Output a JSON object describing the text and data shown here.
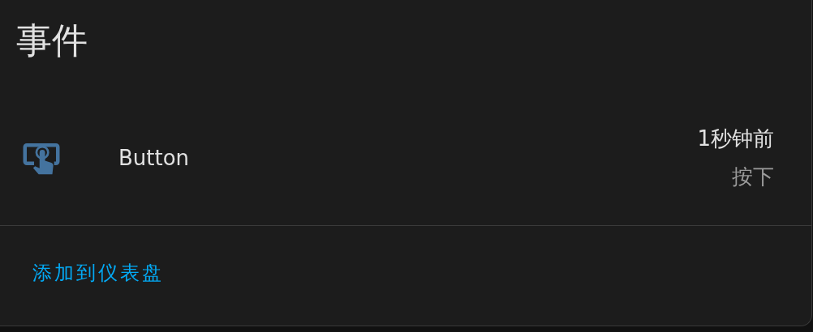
{
  "card": {
    "title": "事件"
  },
  "entity": {
    "name": "Button",
    "time": "1秒钟前",
    "state": "按下"
  },
  "action": {
    "label": "添加到仪表盘"
  }
}
